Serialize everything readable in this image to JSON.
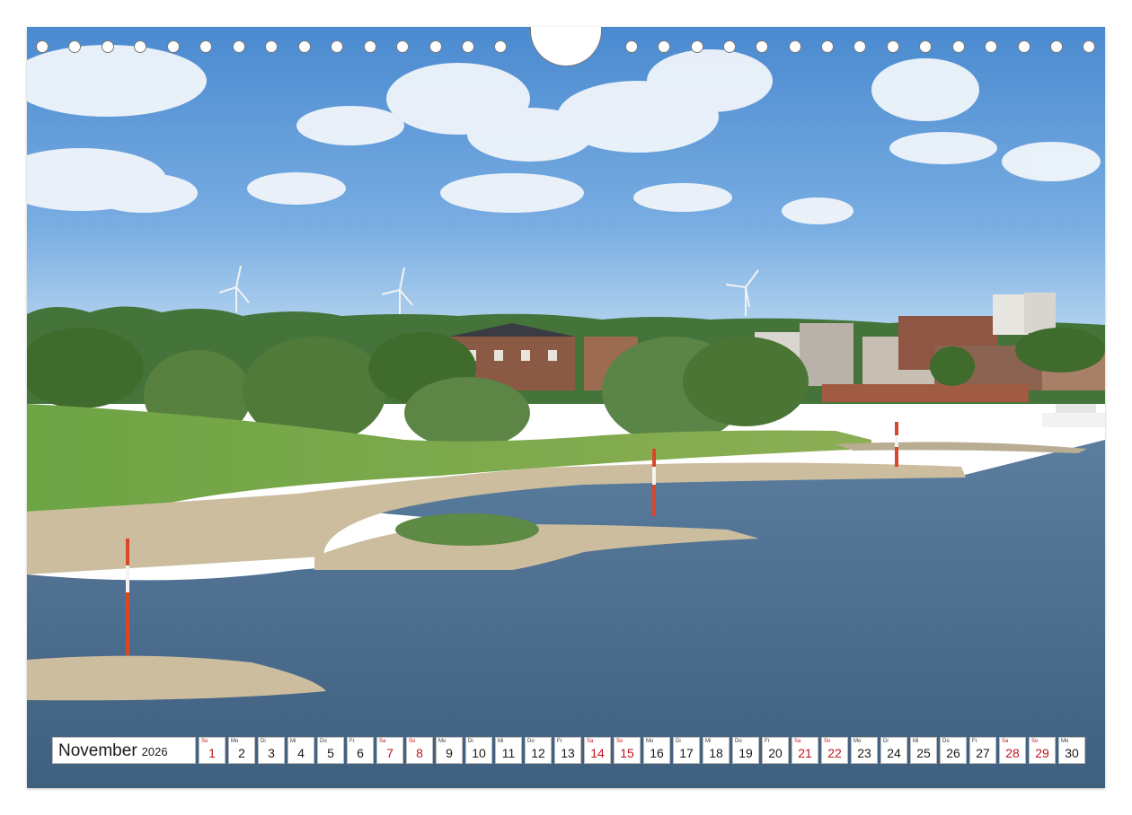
{
  "calendar": {
    "month": "November",
    "year": "2026",
    "weekend_color": "#c0141c",
    "days": [
      {
        "wd": "So",
        "num": "1",
        "weekend": true
      },
      {
        "wd": "Mo",
        "num": "2",
        "weekend": false
      },
      {
        "wd": "Di",
        "num": "3",
        "weekend": false
      },
      {
        "wd": "Mi",
        "num": "4",
        "weekend": false
      },
      {
        "wd": "Do",
        "num": "5",
        "weekend": false
      },
      {
        "wd": "Fr",
        "num": "6",
        "weekend": false
      },
      {
        "wd": "Sa",
        "num": "7",
        "weekend": true
      },
      {
        "wd": "So",
        "num": "8",
        "weekend": true
      },
      {
        "wd": "Mo",
        "num": "9",
        "weekend": false
      },
      {
        "wd": "Di",
        "num": "10",
        "weekend": false
      },
      {
        "wd": "Mi",
        "num": "11",
        "weekend": false
      },
      {
        "wd": "Do",
        "num": "12",
        "weekend": false
      },
      {
        "wd": "Fr",
        "num": "13",
        "weekend": false
      },
      {
        "wd": "Sa",
        "num": "14",
        "weekend": true
      },
      {
        "wd": "So",
        "num": "15",
        "weekend": true
      },
      {
        "wd": "Mo",
        "num": "16",
        "weekend": false
      },
      {
        "wd": "Di",
        "num": "17",
        "weekend": false
      },
      {
        "wd": "Mi",
        "num": "18",
        "weekend": false
      },
      {
        "wd": "Do",
        "num": "19",
        "weekend": false
      },
      {
        "wd": "Fr",
        "num": "20",
        "weekend": false
      },
      {
        "wd": "Sa",
        "num": "21",
        "weekend": true
      },
      {
        "wd": "So",
        "num": "22",
        "weekend": true
      },
      {
        "wd": "Mo",
        "num": "23",
        "weekend": false
      },
      {
        "wd": "Di",
        "num": "24",
        "weekend": false
      },
      {
        "wd": "Mi",
        "num": "25",
        "weekend": false
      },
      {
        "wd": "Do",
        "num": "26",
        "weekend": false
      },
      {
        "wd": "Fr",
        "num": "27",
        "weekend": false
      },
      {
        "wd": "Sa",
        "num": "28",
        "weekend": true
      },
      {
        "wd": "So",
        "num": "29",
        "weekend": true
      },
      {
        "wd": "Mo",
        "num": "30",
        "weekend": false
      }
    ]
  },
  "colors": {
    "sky_top": "#4f8fd3",
    "sky_bottom": "#a9cdf0",
    "river": "#4d6e8e",
    "meadow": "#6fa547",
    "trees": "#3f6b2c",
    "sandbank": "#c9bb9c",
    "marker_red": "#d9472b"
  }
}
